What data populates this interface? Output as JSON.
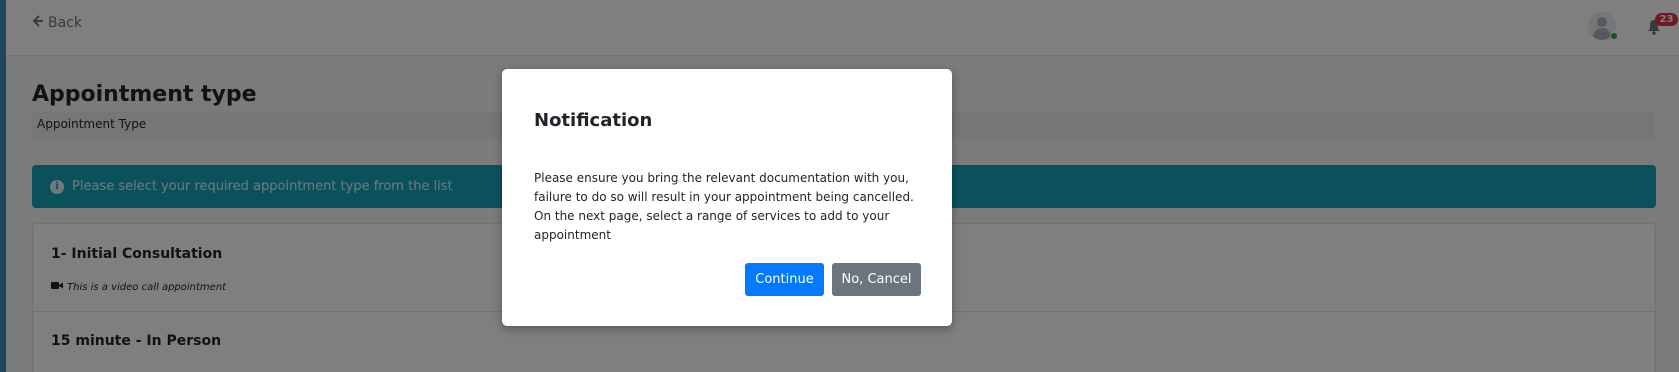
{
  "header": {
    "back_label": "Back",
    "notification_count": "23"
  },
  "page": {
    "title": "Appointment type",
    "breadcrumb": "Appointment Type",
    "alert": "Please select your required appointment type from the list"
  },
  "appointment_types": [
    {
      "name": "1- Initial Consultation",
      "note": "This is a video call appointment"
    },
    {
      "name": "15 minute - In Person"
    }
  ],
  "modal": {
    "title": "Notification",
    "body": "Please ensure you bring the relevant documentation with you, failure to do so will result in your appointment being cancelled. On the next page, select a range of services to add to your appointment",
    "continue_label": "Continue",
    "cancel_label": "No, Cancel"
  },
  "icons": {
    "back": "arrow-left-icon",
    "avatar": "user-avatar-icon",
    "notifications": "bell-icon",
    "info": "info-circle-icon",
    "video": "video-camera-icon"
  },
  "colors": {
    "primary": "#007bff",
    "secondary": "#6c757d",
    "info": "#17a2b8",
    "danger": "#dc3545",
    "online": "#28a745"
  }
}
